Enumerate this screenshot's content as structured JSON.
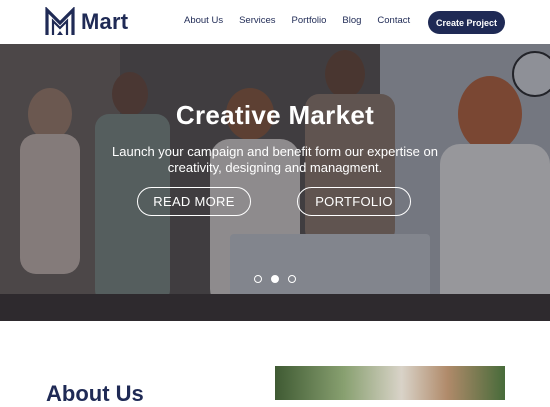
{
  "brand": {
    "name": "Mart",
    "color": "#1f2a55"
  },
  "nav": {
    "items": [
      "About Us",
      "Services",
      "Portfolio",
      "Blog",
      "Contact"
    ],
    "cta_label": "Create Project"
  },
  "hero": {
    "title": "Creative Market",
    "subtitle": "Launch your campaign and benefit form our expertise on creativity, designing and managment.",
    "primary_button": "READ MORE",
    "secondary_button": "PORTFOLIO",
    "slides": 3,
    "active_slide": 2
  },
  "about": {
    "title": "About Us"
  }
}
